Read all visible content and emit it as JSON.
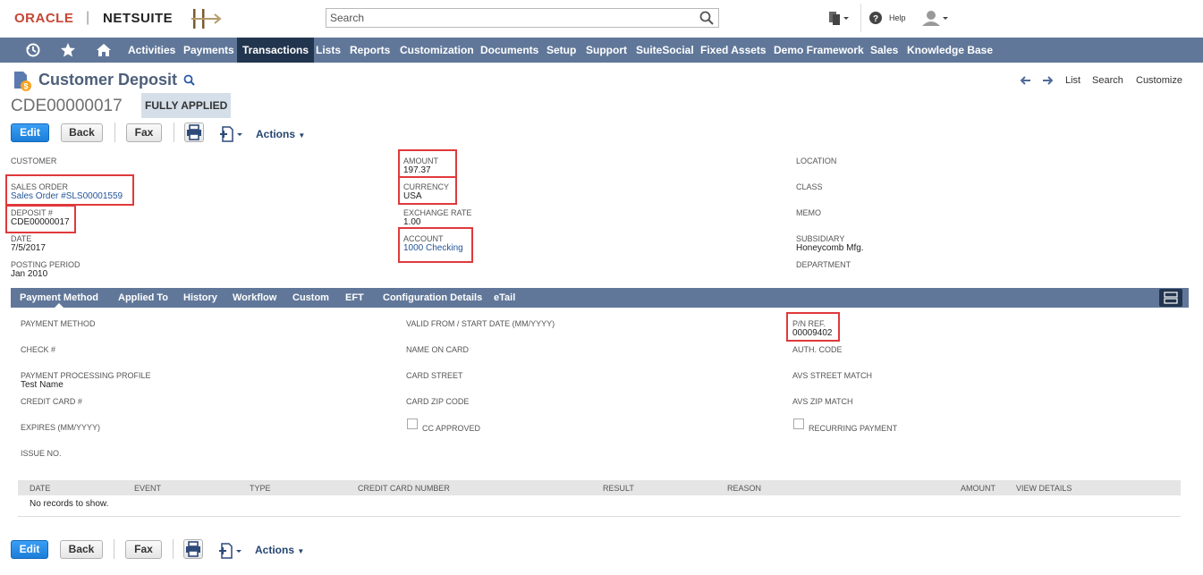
{
  "header": {
    "brand_oracle": "ORACLE",
    "brand_separator": "|",
    "brand_netsuite": "NETSUITE",
    "search_placeholder": "Search",
    "help_label": "Help",
    "icons": [
      "search-icon",
      "recent-records-icon",
      "help-icon",
      "user-icon",
      "company-logo-icon"
    ]
  },
  "nav": {
    "items": [
      "Activities",
      "Payments",
      "Transactions",
      "Lists",
      "Reports",
      "Customization",
      "Documents",
      "Setup",
      "Support",
      "SuiteSocial",
      "Fixed Assets",
      "Demo Framework",
      "Sales",
      "Knowledge Base"
    ],
    "active": "Transactions",
    "icons": [
      "recent-icon",
      "star-icon",
      "home-icon"
    ],
    "bar_color": "#607799",
    "active_color": "#22354e"
  },
  "record": {
    "title": "Customer Deposit",
    "id": "CDE00000017",
    "status": "FULLY APPLIED",
    "top_links": [
      "List",
      "Search",
      "Customize"
    ]
  },
  "buttons": {
    "edit": "Edit",
    "back": "Back",
    "fax": "Fax",
    "actions": "Actions"
  },
  "fields": {
    "customer": {
      "label": "CUSTOMER",
      "value": ""
    },
    "sales_order": {
      "label": "SALES ORDER",
      "value": "Sales Order #SLS00001559"
    },
    "deposit_no": {
      "label": "DEPOSIT #",
      "value": "CDE00000017"
    },
    "date": {
      "label": "DATE",
      "value": "7/5/2017"
    },
    "posting_period": {
      "label": "POSTING PERIOD",
      "value": "Jan 2010"
    },
    "amount": {
      "label": "AMOUNT",
      "value": "197.37"
    },
    "currency": {
      "label": "CURRENCY",
      "value": "USA"
    },
    "exchange_rate": {
      "label": "EXCHANGE RATE",
      "value": "1.00"
    },
    "account": {
      "label": "ACCOUNT",
      "value": "1000 Checking"
    },
    "location": {
      "label": "LOCATION",
      "value": ""
    },
    "class": {
      "label": "CLASS",
      "value": ""
    },
    "memo": {
      "label": "MEMO",
      "value": ""
    },
    "subsidiary": {
      "label": "SUBSIDIARY",
      "value": "Honeycomb Mfg."
    },
    "department": {
      "label": "DEPARTMENT",
      "value": ""
    }
  },
  "subtabs": {
    "items": [
      "Payment Method",
      "Applied To",
      "History",
      "Workflow",
      "Custom",
      "EFT",
      "Configuration Details",
      "eTail"
    ],
    "active": "Payment Method"
  },
  "payment": {
    "payment_method": {
      "label": "PAYMENT METHOD",
      "value": ""
    },
    "check_no": {
      "label": "CHECK #",
      "value": ""
    },
    "processing_profile": {
      "label": "PAYMENT PROCESSING PROFILE",
      "value": "Test Name"
    },
    "credit_card_no": {
      "label": "CREDIT CARD #",
      "value": ""
    },
    "expires": {
      "label": "EXPIRES (MM/YYYY)",
      "value": ""
    },
    "issue_no": {
      "label": "ISSUE NO.",
      "value": ""
    },
    "valid_from": {
      "label": "VALID FROM / START DATE (MM/YYYY)",
      "value": ""
    },
    "name_on_card": {
      "label": "NAME ON CARD",
      "value": ""
    },
    "card_street": {
      "label": "CARD STREET",
      "value": ""
    },
    "card_zip": {
      "label": "CARD ZIP CODE",
      "value": ""
    },
    "cc_approved": {
      "label": "CC APPROVED",
      "checked": false
    },
    "pn_ref": {
      "label": "P/N REF.",
      "value": "00009402"
    },
    "auth_code": {
      "label": "AUTH. CODE",
      "value": ""
    },
    "avs_street": {
      "label": "AVS STREET MATCH",
      "value": ""
    },
    "avs_zip": {
      "label": "AVS ZIP MATCH",
      "value": ""
    },
    "recurring": {
      "label": "RECURRING PAYMENT",
      "checked": false
    }
  },
  "table": {
    "columns": [
      "DATE",
      "EVENT",
      "TYPE",
      "CREDIT CARD NUMBER",
      "RESULT",
      "REASON",
      "AMOUNT",
      "VIEW DETAILS"
    ],
    "empty_text": "No records to show."
  },
  "highlight_color": "#e0393b"
}
